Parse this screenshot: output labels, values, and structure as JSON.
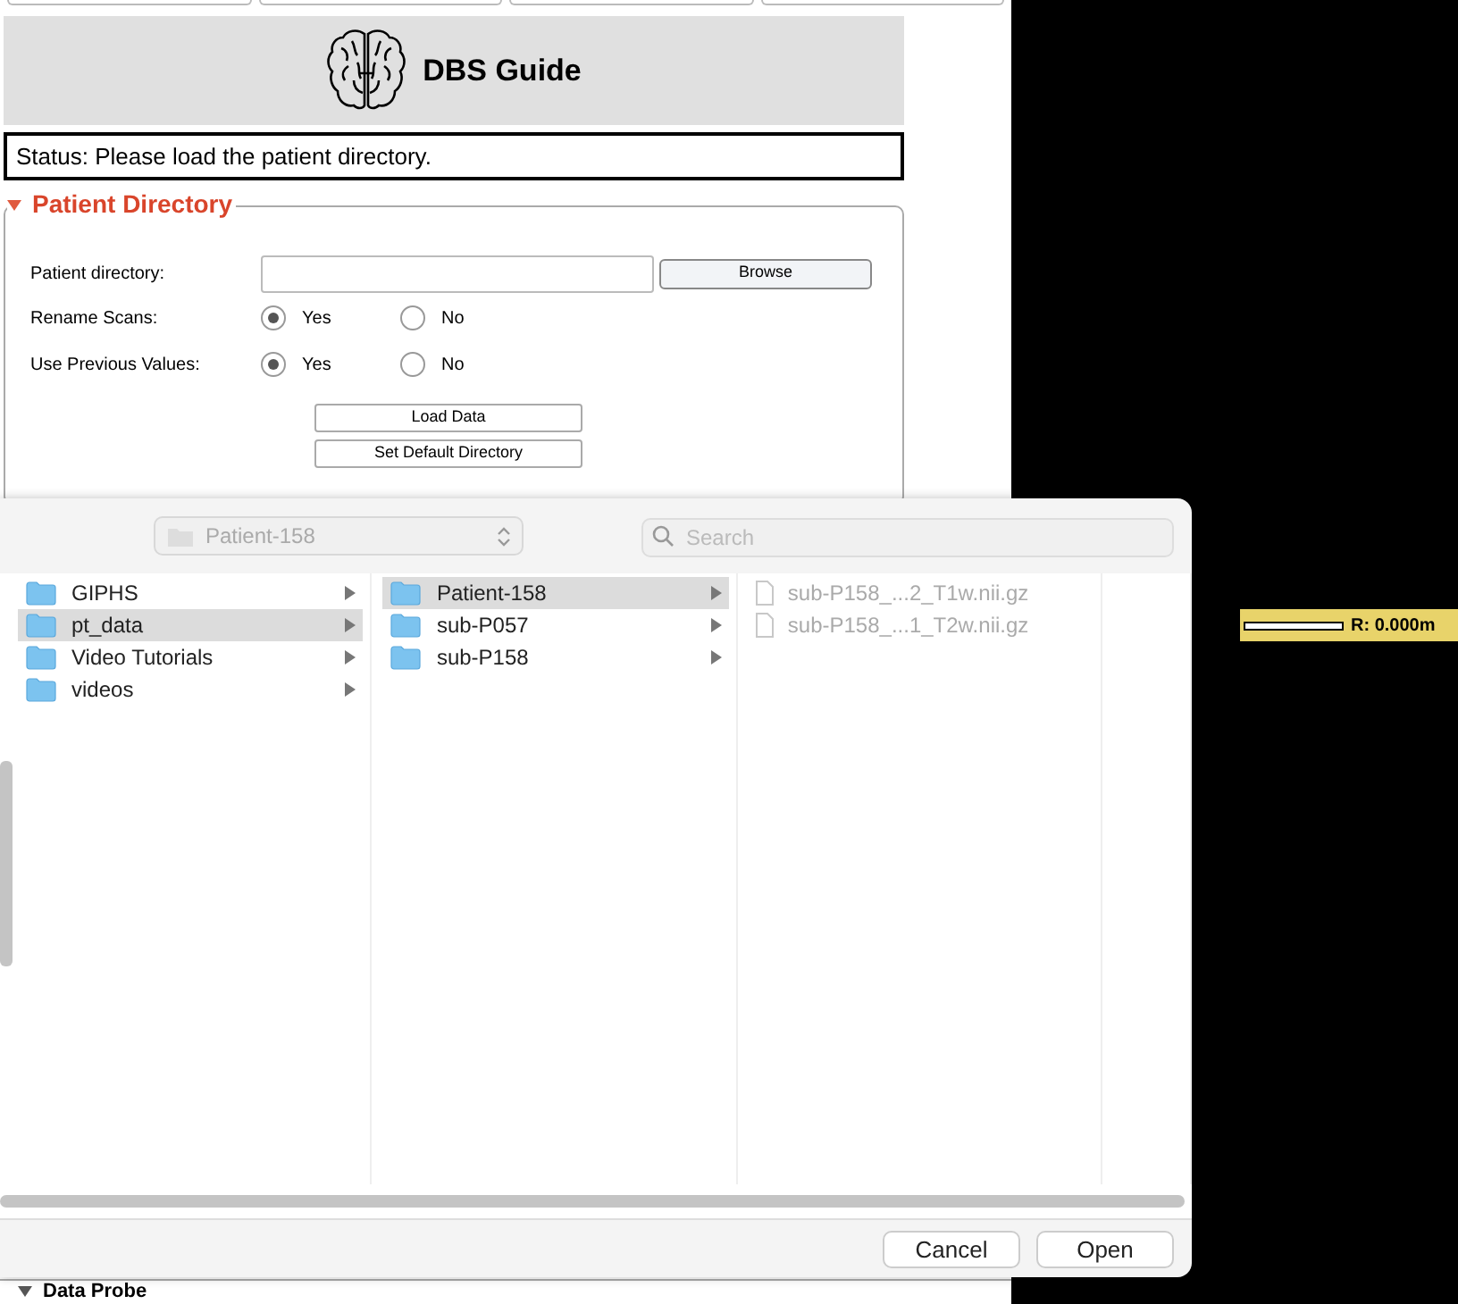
{
  "app": {
    "title": "DBS Guide",
    "status": "Status: Please load the patient directory.",
    "section": {
      "title": "Patient Directory",
      "expanded": true,
      "directory_label": "Patient directory:",
      "browse": "Browse",
      "radio_groups": [
        {
          "label": "Rename Scans:",
          "options": [
            {
              "label": "Yes",
              "selected": true
            },
            {
              "label": "No",
              "selected": false
            }
          ]
        },
        {
          "label": "Use Previous Values:",
          "options": [
            {
              "label": "Yes",
              "selected": true
            },
            {
              "label": "No",
              "selected": false
            }
          ]
        }
      ],
      "buttons": [
        "Load Data",
        "Set Default Directory"
      ]
    },
    "next_section": {
      "title": "Data Probe",
      "expanded": true
    }
  },
  "slider": {
    "reading": "R: 0.000m"
  },
  "dialog": {
    "location": "Patient-158",
    "search_placeholder": "Search",
    "columns": [
      [
        {
          "name": "GIPHS",
          "kind": "folder",
          "selected": false
        },
        {
          "name": "pt_data",
          "kind": "folder",
          "selected": true
        },
        {
          "name": "Video Tutorials",
          "kind": "folder",
          "selected": false
        },
        {
          "name": "videos",
          "kind": "folder",
          "selected": false
        }
      ],
      [
        {
          "name": "Patient-158",
          "kind": "folder",
          "selected": true
        },
        {
          "name": "sub-P057",
          "kind": "folder",
          "selected": false
        },
        {
          "name": "sub-P158",
          "kind": "folder",
          "selected": false
        }
      ],
      [
        {
          "name": "sub-P158_...2_T1w.nii.gz",
          "kind": "file",
          "selected": false
        },
        {
          "name": "sub-P158_...1_T2w.nii.gz",
          "kind": "file",
          "selected": false
        }
      ]
    ],
    "buttons": [
      "Cancel",
      "Open"
    ]
  }
}
